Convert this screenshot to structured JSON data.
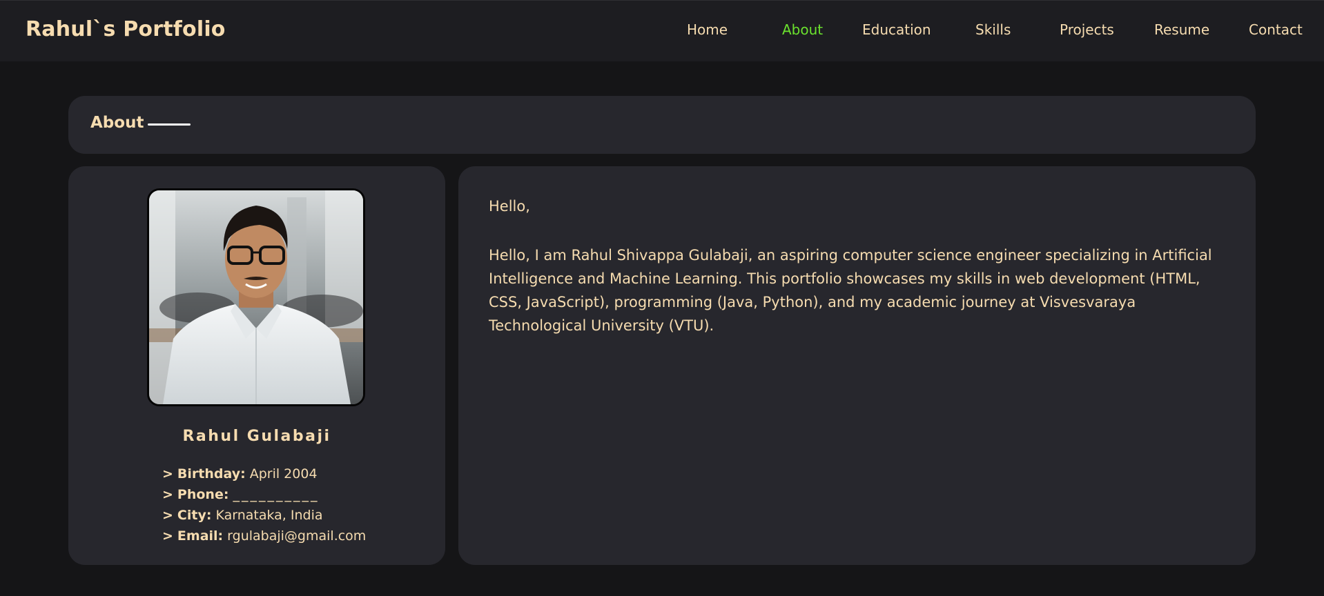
{
  "brand": "Rahul`s Portfolio",
  "nav": {
    "items": [
      "Home",
      "About",
      "Education",
      "Skills",
      "Projects",
      "Resume",
      "Contact"
    ],
    "active": "About"
  },
  "about_section": {
    "title": "About"
  },
  "profile": {
    "name": "Rahul Gulabaji",
    "chevron": ">",
    "birthday_label": "Birthday:",
    "birthday_value": "April 2004",
    "phone_label": "Phone:",
    "phone_value": "__________",
    "city_label": "City:",
    "city_value": "Karnataka, India",
    "email_label": "Email:",
    "email_value": "rgulabaji@gmail.com"
  },
  "bio": {
    "greeting": "Hello,",
    "text": "Hello, I am Rahul Shivappa Gulabaji, an aspiring computer science engineer specializing in Artificial Intelligence and Machine Learning. This portfolio showcases my skills in web development (HTML, CSS, JavaScript), programming (Java, Python), and my academic journey at Visvesvaraya Technological University (VTU)."
  },
  "colors": {
    "accent_active": "#6be22e",
    "text": "#f6dcb0",
    "background": "#151517",
    "card": "#27272d",
    "navbar": "#1d1d21"
  }
}
